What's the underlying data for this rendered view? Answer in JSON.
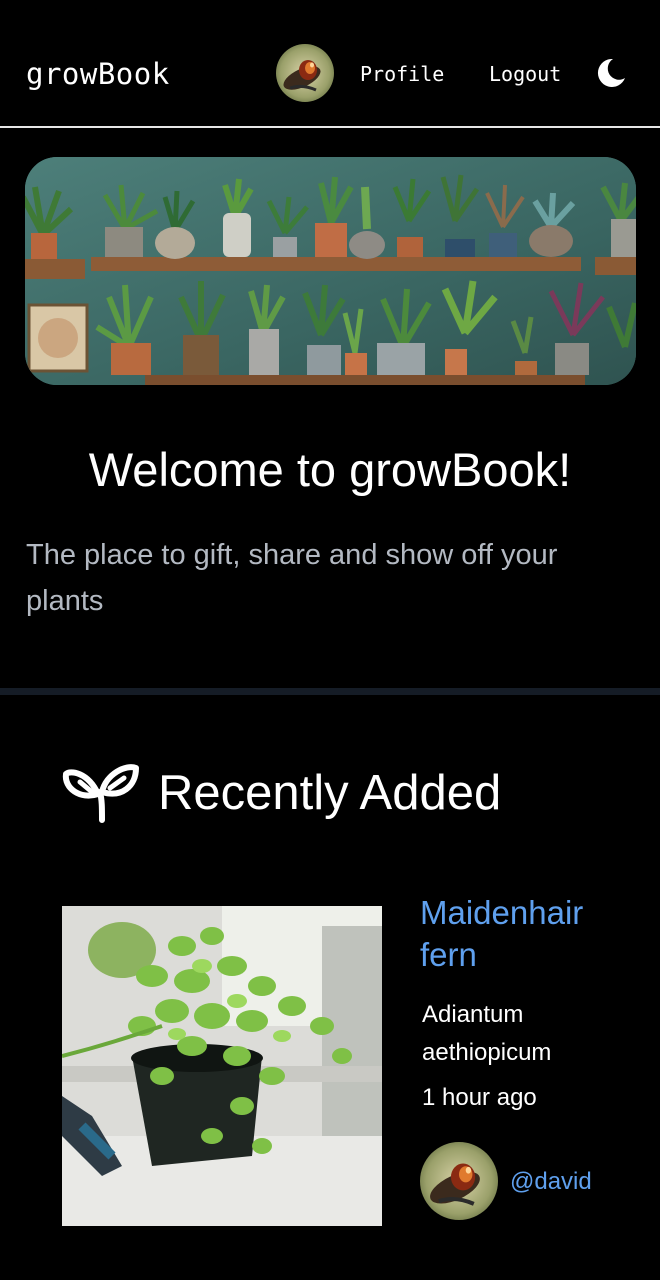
{
  "navbar": {
    "brand": "growBook",
    "profile_label": "Profile",
    "logout_label": "Logout",
    "theme_icon": "moon-icon"
  },
  "hero": {
    "title": "Welcome to growBook!",
    "subtitle": "The place to gift, share and show off your plants"
  },
  "recent": {
    "icon": "sprout-icon",
    "title": "Recently Added",
    "items": [
      {
        "common_name": "Maidenhair fern",
        "scientific_name": "Adiantum aethiopicum",
        "added": "1 hour ago",
        "owner": "@david"
      }
    ]
  },
  "colors": {
    "background": "#000000",
    "link": "#5fa0ee",
    "muted_text": "#b3b9c2",
    "divider": "#151c26"
  }
}
